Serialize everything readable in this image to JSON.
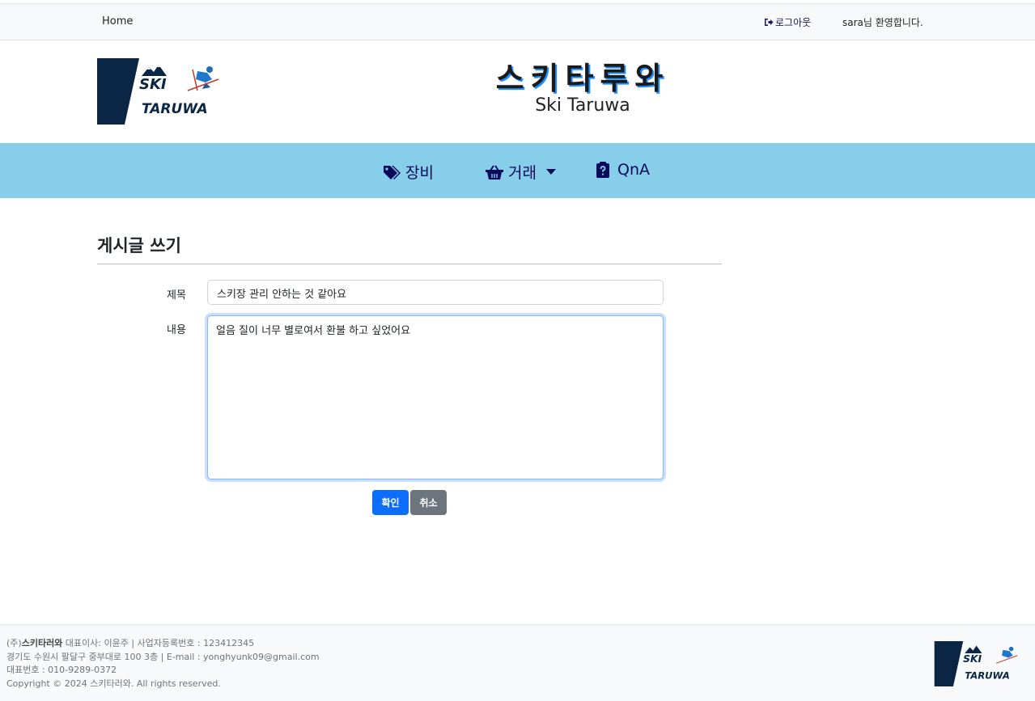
{
  "topbar": {
    "home": "Home",
    "logout": "로그아웃",
    "welcome": "sara님 환영합니다."
  },
  "header": {
    "logo_text_top": "SKI",
    "logo_text_bottom": "TARUWA",
    "title": "스키타루와",
    "subtitle": "Ski Taruwa"
  },
  "nav": {
    "items": [
      {
        "label": "장비",
        "icon": "tags-icon"
      },
      {
        "label": "거래",
        "icon": "basket-icon",
        "dropdown": true
      },
      {
        "label": "QnA",
        "icon": "clipboard-question-icon"
      }
    ]
  },
  "form": {
    "heading": "게시글 쓰기",
    "title_label": "제목",
    "title_value": "스키장 관리 안하는 것 같아요",
    "content_label": "내용",
    "content_value": "얼음 질이 너무 별로여서 환불 하고 싶었어요",
    "submit": "확인",
    "cancel": "취소"
  },
  "footer": {
    "company_prefix": "(주)",
    "company": "스키타러와",
    "line1_rest": " 대표이사: 이윤주 | 사업자등록번호 : 123412345",
    "line2": "경기도 수원시 팔달구 중부대로 100 3층 | E-mail : yonghyunk09@gmail.com",
    "line3": "대표번호 : 010-9289-0372",
    "line4": "Copyright © 2024 스키타러와. All rights reserved."
  },
  "colors": {
    "nav_bg": "#87ceeb",
    "primary": "#0d6efd",
    "secondary": "#6c757d",
    "logo_navy": "#0b2545"
  }
}
